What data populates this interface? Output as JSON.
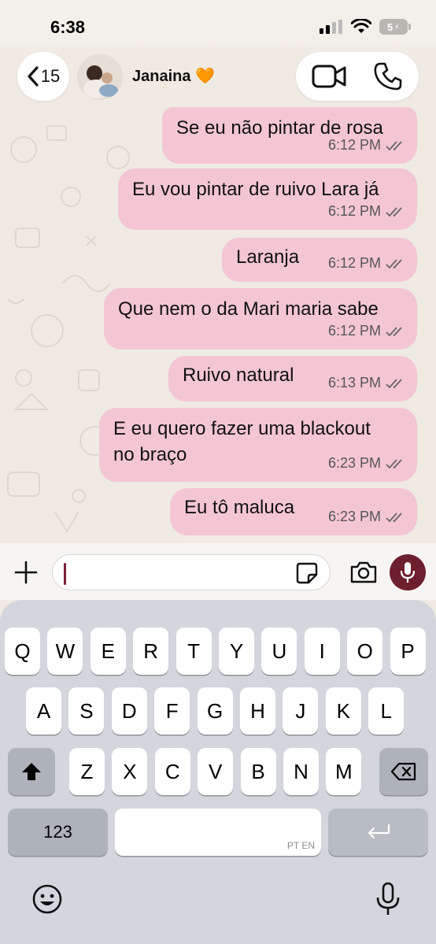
{
  "status_bar": {
    "time": "6:38",
    "battery": "5"
  },
  "header": {
    "back_count": "15",
    "contact_name": "Janaina 🧡",
    "icons": [
      "chevron-left-icon",
      "video-camera-icon",
      "phone-icon"
    ]
  },
  "messages": [
    {
      "text": "Se eu não pintar de rosa",
      "time": "6:12 PM"
    },
    {
      "text": "Eu vou pintar de ruivo Lara já",
      "time": "6:12 PM"
    },
    {
      "text": "Laranja",
      "time": "6:12 PM"
    },
    {
      "text": "Que nem o da Mari maria sabe",
      "time": "6:12 PM"
    },
    {
      "text": "Ruivo natural",
      "time": "6:13 PM"
    },
    {
      "text": "E eu quero fazer uma blackout no braço",
      "time": "6:23 PM"
    },
    {
      "text": "Eu tô maluca",
      "time": "6:23 PM"
    }
  ],
  "input": {
    "placeholder": "",
    "icons": [
      "plus-icon",
      "sticker-icon",
      "camera-icon",
      "microphone-icon"
    ]
  },
  "keyboard": {
    "row1": [
      "Q",
      "W",
      "E",
      "R",
      "T",
      "Y",
      "U",
      "I",
      "O",
      "P"
    ],
    "row2": [
      "A",
      "S",
      "D",
      "F",
      "G",
      "H",
      "J",
      "K",
      "L"
    ],
    "row3": [
      "Z",
      "X",
      "C",
      "V",
      "B",
      "N",
      "M"
    ],
    "numbers_key": "123",
    "space_languages": "PT EN"
  },
  "colors": {
    "bubble": "#f4c6d4",
    "mic_button": "#6e1f2e",
    "caret": "#7a2238"
  }
}
